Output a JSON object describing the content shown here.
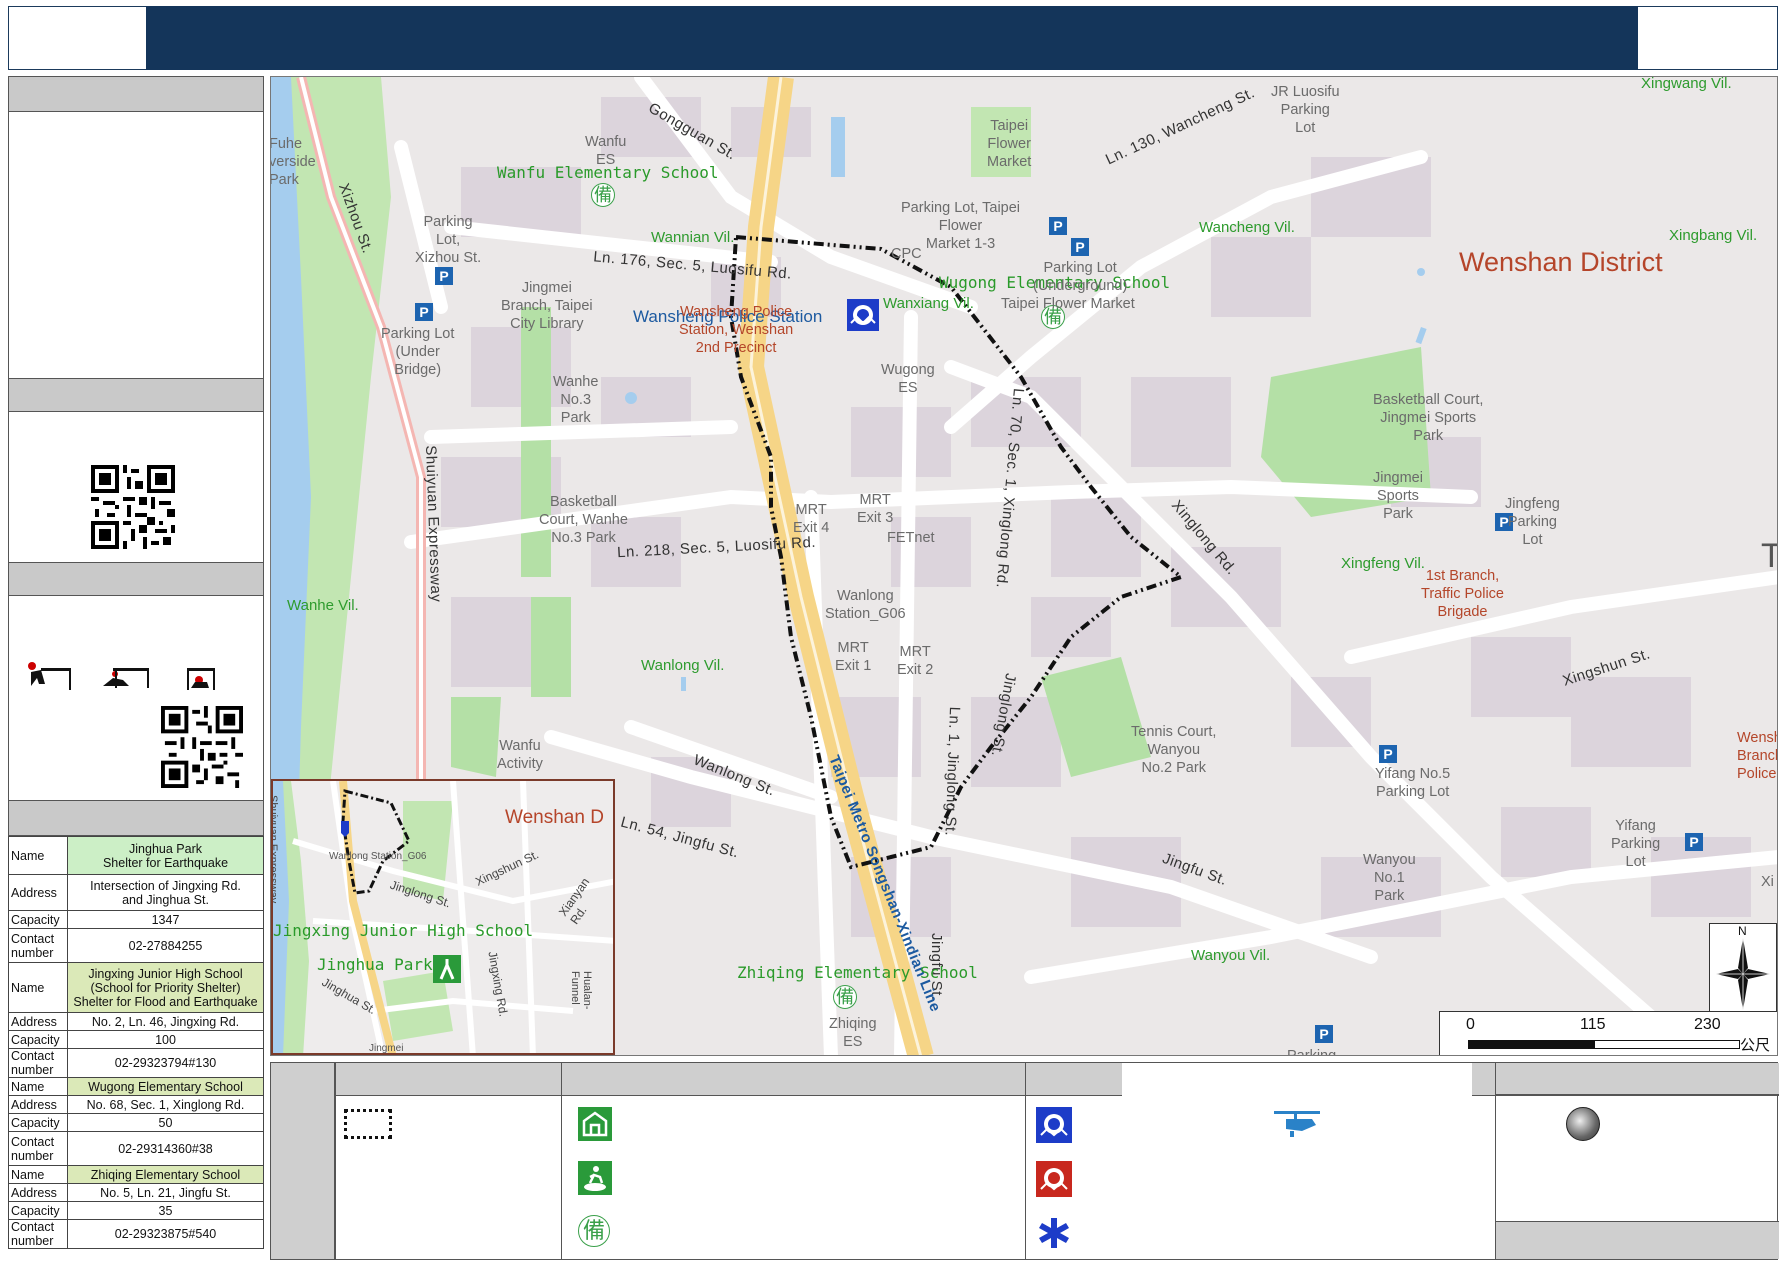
{
  "map": {
    "district": "Wenshan District",
    "villages": [
      "Xingwang Vil.",
      "Wannian Vil.",
      "Wancheng Vil.",
      "Xingbang Vil.",
      "Wanxiang Vil.",
      "Wanhe Vil.",
      "Wanlong Vil.",
      "Xingfeng Vil.",
      "Wanyou Vil."
    ],
    "roads": [
      "Gongguan St.",
      "Xizhou St.",
      "Ln. 176, Sec. 5, Luosifu Rd.",
      "Ln. 218, Sec. 5, Luosifu Rd.",
      "Ln. 130, Wancheng St.",
      "Shuiyuan Expressway",
      "Ln. 70, Sec. 1, Xinglong Rd.",
      "Xinglong Rd.",
      "Jinglong St.",
      "Ln. 1, Jinglong St.",
      "Wanlong St.",
      "Ln. 54, Jingfu St.",
      "Jingfu St.",
      "Xingshun St.",
      "Jingfu St.",
      "Taipei Metro Songshan-Xindian Line"
    ],
    "schools": [
      "Wanfu Elementary School",
      "Wugong Elementary School",
      "Zhiqing Elementary School"
    ],
    "police": "Wansheng Police Station",
    "places": {
      "fuhe": "Fuhe\nverside\nPark",
      "wanfu_es": "Wanfu\nES",
      "parking_xizhou": "Parking\nLot,\nXizhou St.",
      "parking_under_bridge": "Parking Lot\n(Under\nBridge)",
      "jingmei_library": "Jingmei\nBranch, Taipei\nCity Library",
      "wanhe_park": "Wanhe\nNo.3\nPark",
      "basketball_wanhe": "Basketball\nCourt, Wanhe\nNo.3 Park",
      "wanfu_activity": "Wanfu\nActivity",
      "taipei_flower_market": "Taipei\nFlower\nMarket",
      "parking_flower": "Parking Lot, Taipei\nFlower\nMarket 1-3",
      "cpc": "CPC",
      "parking_underground": "Parking Lot\n(Underground)",
      "flower_market_2": "Taipei Flower Market",
      "jr_luosifu": "JR Luosifu\nParking\nLot",
      "wugong_es": "Wugong\nES",
      "wansheng_sub": "Wansheng Police\nStation, Wenshan\n2nd Precinct",
      "mrt_exit4": "MRT\nExit 4",
      "mrt_exit3": "MRT\nExit 3",
      "fetnet": "FETnet",
      "wanlong_station": "Wanlong\nStation_G06",
      "mrt_exit1": "MRT\nExit 1",
      "mrt_exit2": "MRT\nExit 2",
      "basketball_jingmei": "Basketball Court,\nJingmei Sports\nPark",
      "jingmei_sports": "Jingmei\nSports\nPark",
      "jingfeng_parking": "Jingfeng\nParking\nLot",
      "traffic_police": "1st Branch,\nTraffic Police\nBrigade",
      "tennis": "Tennis Court,\nWanyou\nNo.2 Park",
      "yifang5": "Yifang No.5\nParking Lot",
      "wanyou1": "Wanyou\nNo.1\nPark",
      "yifang_parking": "Yifang\nParking\nLot",
      "wenshan_branch": "Wensh\nBranch\nPolice",
      "zhiqing_es": "Zhiqing\nES",
      "parking_bottom": "Parking",
      "xi_cut": "Xi",
      "t_cut": "T"
    },
    "scale": {
      "ticks": [
        "0",
        "115",
        "230"
      ],
      "unit": "公尺"
    },
    "north": "N"
  },
  "inset": {
    "district": "Wenshan D",
    "labels": [
      "Xingshun St.",
      "Xianyan Rd.",
      "Jinglong St.",
      "Jingxing Rd.",
      "Jingxing Junior High School",
      "Jinghua Park",
      "Jinghua St.",
      "Shuiyuan Expressway",
      "Wanlong Station_G06",
      "Hualan-Funnel",
      "Jingmei"
    ]
  },
  "shelters": [
    {
      "name_label": "Name",
      "name": "Jinghua Park\nShelter for Earthquake",
      "address_label": "Address",
      "address": "Intersection of Jingxing Rd.\nand Jinghua St.",
      "capacity_label": "Capacity",
      "capacity": "1347",
      "contact_label": "Contact\nnumber",
      "contact": "02-27884255"
    },
    {
      "name_label": "Name",
      "name": "Jingxing Junior High School\n(School for Priority Shelter)\nShelter for Flood and Earthquake",
      "address_label": "Address",
      "address": "No. 2, Ln. 46, Jingxing Rd.",
      "capacity_label": "Capacity",
      "capacity": "100",
      "contact_label": "Contact\nnumber",
      "contact": "02-29323794#130"
    },
    {
      "name_label": "Name",
      "name": "Wugong Elementary School",
      "address_label": "Address",
      "address": "No. 68, Sec. 1, Xinglong Rd.",
      "capacity_label": "Capacity",
      "capacity": "50",
      "contact_label": "Contact\nnumber",
      "contact": "02-29314360#38"
    },
    {
      "name_label": "Name",
      "name": "Zhiqing Elementary School",
      "address_label": "Address",
      "address": "No. 5, Ln. 21, Jingfu St.",
      "capacity_label": "Capacity",
      "capacity": "35",
      "contact_label": "Contact\nnumber",
      "contact": "02-29323875#540"
    }
  ],
  "icons": {
    "bei": "備",
    "parking": "P"
  }
}
